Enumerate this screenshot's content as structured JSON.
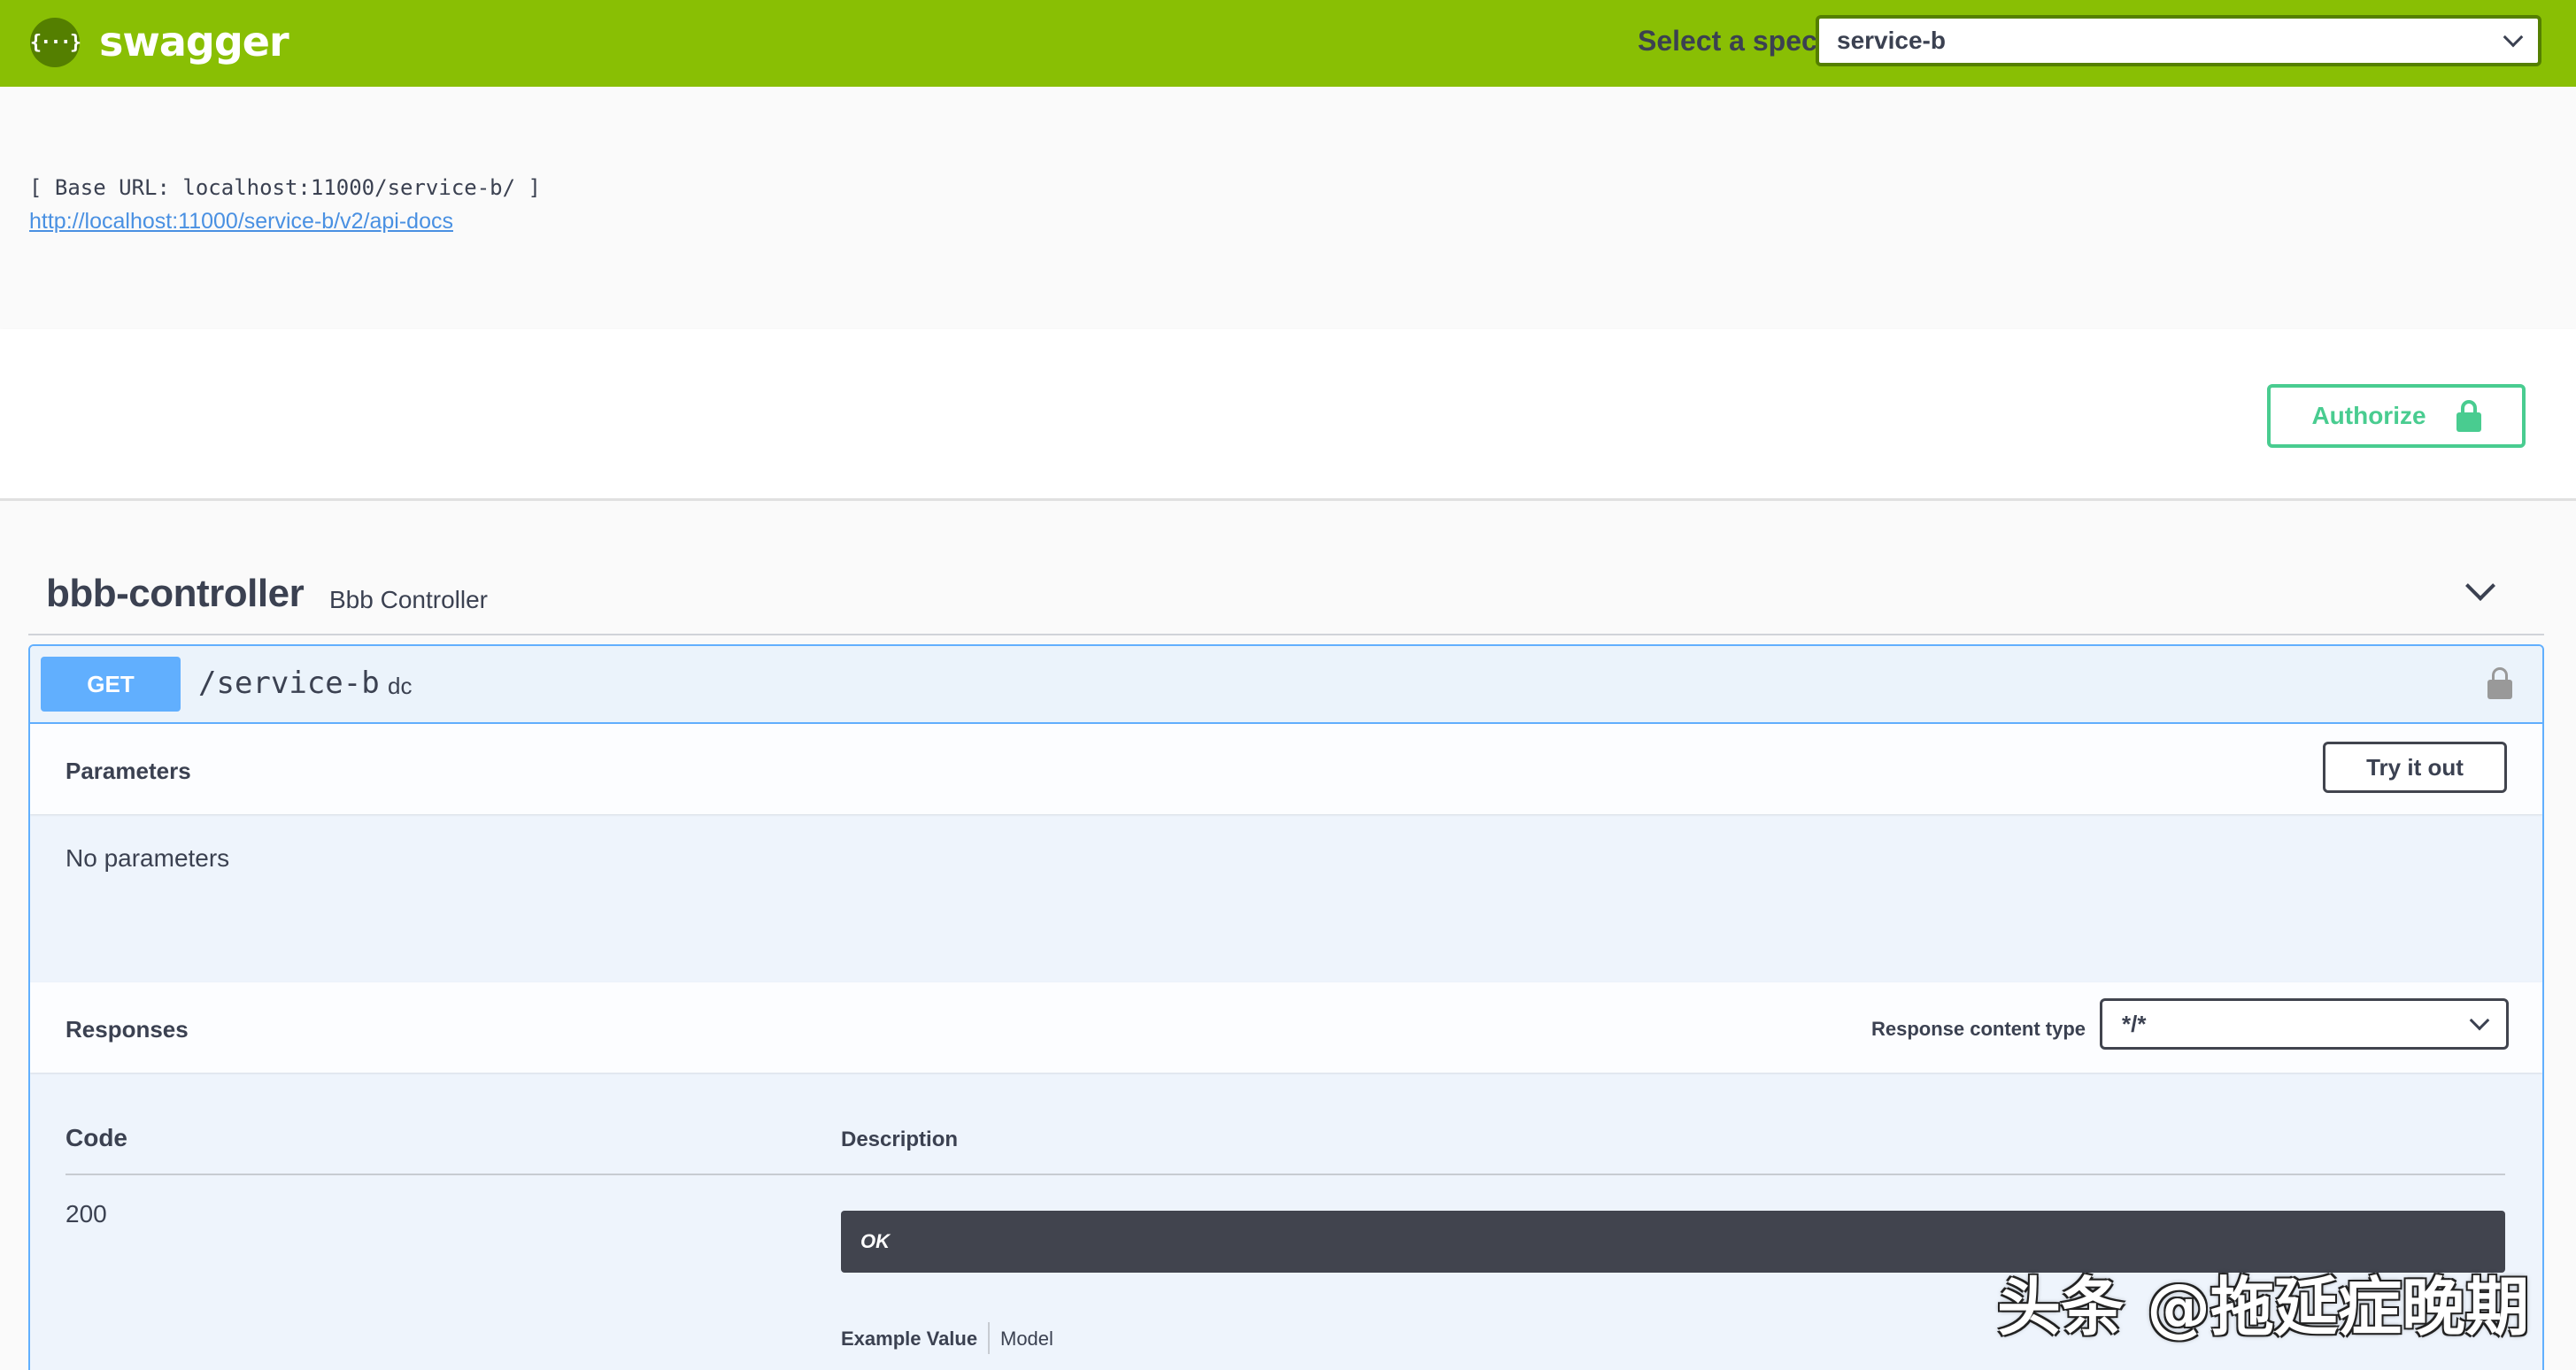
{
  "topbar": {
    "logo_glyph": "{···}",
    "brand": "swagger",
    "spec_label": "Select a spec",
    "spec_value": "service-b"
  },
  "info": {
    "base_url": "[ Base URL: localhost:11000/service-b/ ]",
    "api_docs_link": "http://localhost:11000/service-b/v2/api-docs"
  },
  "auth": {
    "authorize_label": "Authorize"
  },
  "tag": {
    "name": "bbb-controller",
    "description": "Bbb Controller"
  },
  "operation": {
    "method": "GET",
    "path": "/service-b",
    "summary": "dc",
    "parameters_title": "Parameters",
    "try_it_out_label": "Try it out",
    "no_parameters": "No parameters",
    "responses_title": "Responses",
    "response_content_type_label": "Response content type",
    "response_content_type_value": "*/*",
    "responses_table": {
      "headers": [
        "Code",
        "Description"
      ],
      "rows": [
        {
          "code": "200",
          "description": "OK"
        }
      ]
    },
    "example_value_tab": "Example Value",
    "model_tab": "Model"
  },
  "watermark": "头条 @拖延症晚期",
  "colors": {
    "topbar": "#89bf04",
    "get_method": "#61affe",
    "authorize": "#49cc90",
    "dark_box": "#41444e"
  }
}
